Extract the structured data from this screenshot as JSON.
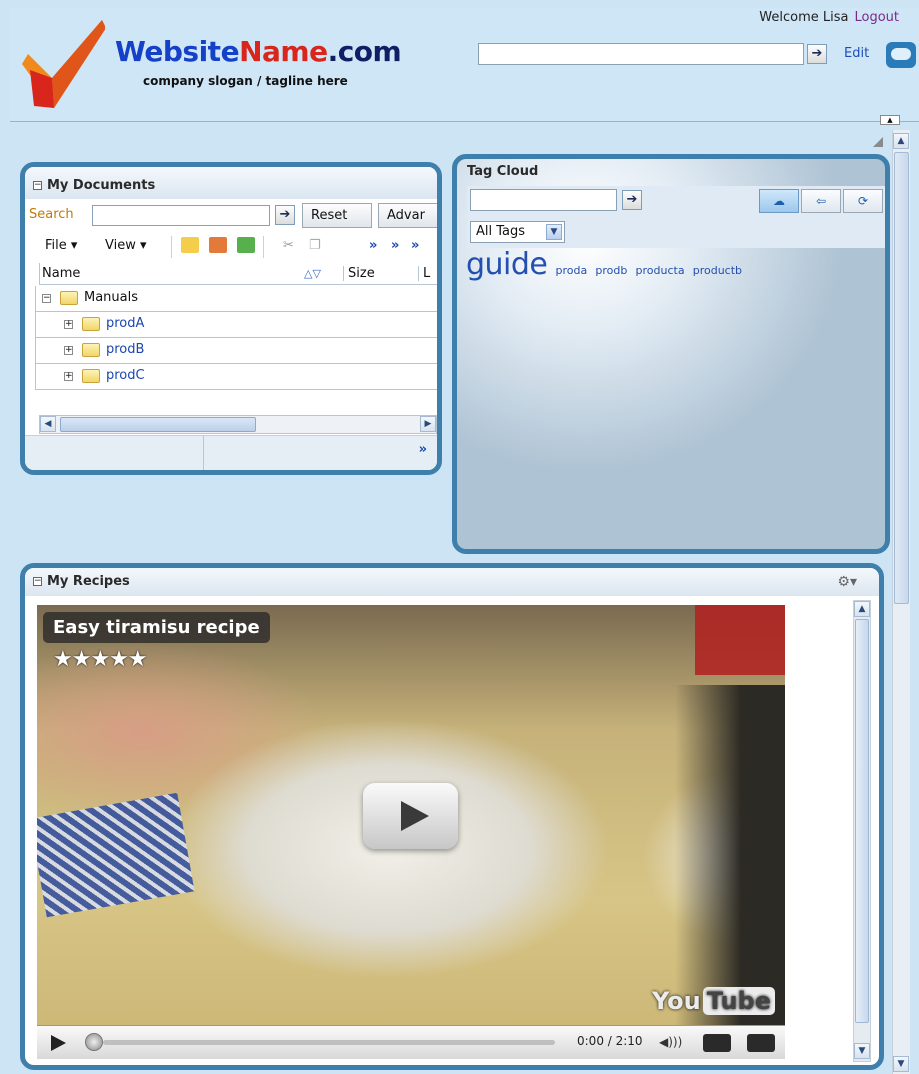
{
  "header": {
    "site_name_part1": "Website",
    "site_name_part2": "Name",
    "site_name_part3": ".com",
    "tagline": "company slogan / tagline here",
    "welcome_text": "Welcome Lisa",
    "logout_label": "Logout",
    "edit_label": "Edit"
  },
  "documents": {
    "title": "My Documents",
    "search_label": "Search",
    "reset_label": "Reset",
    "advanced_label": "Advar",
    "file_menu": "File ▾",
    "view_menu": "View ▾",
    "overflow_1": "»",
    "overflow_2": "»",
    "overflow_3": "»",
    "columns": {
      "name": "Name",
      "size": "Size",
      "last": "L"
    },
    "tree": [
      {
        "label": "Manuals",
        "expander": "⊟"
      },
      {
        "label": "prodA",
        "expander": "⊞"
      },
      {
        "label": "prodB",
        "expander": "⊞"
      },
      {
        "label": "prodC",
        "expander": "⊞"
      }
    ],
    "footer_more": "»"
  },
  "tagcloud": {
    "title": "Tag Cloud",
    "filter_value": "All Tags",
    "tags": [
      {
        "label": "guide",
        "size": "large"
      },
      {
        "label": "proda",
        "size": "small"
      },
      {
        "label": "prodb",
        "size": "small"
      },
      {
        "label": "producta",
        "size": "small"
      },
      {
        "label": "productb",
        "size": "small"
      }
    ]
  },
  "recipes": {
    "title": "My Recipes",
    "video_title": "Easy tiramisu recipe",
    "rating": 5,
    "stars": "★★★★★",
    "time_display": "0:00 / 2:10",
    "youtube_you": "You",
    "youtube_tube": "Tube"
  },
  "colors": {
    "portlet_border": "#3f7fab",
    "page_background": "#cde4f5",
    "link": "#1a47b0",
    "logout": "#7a2a86"
  }
}
